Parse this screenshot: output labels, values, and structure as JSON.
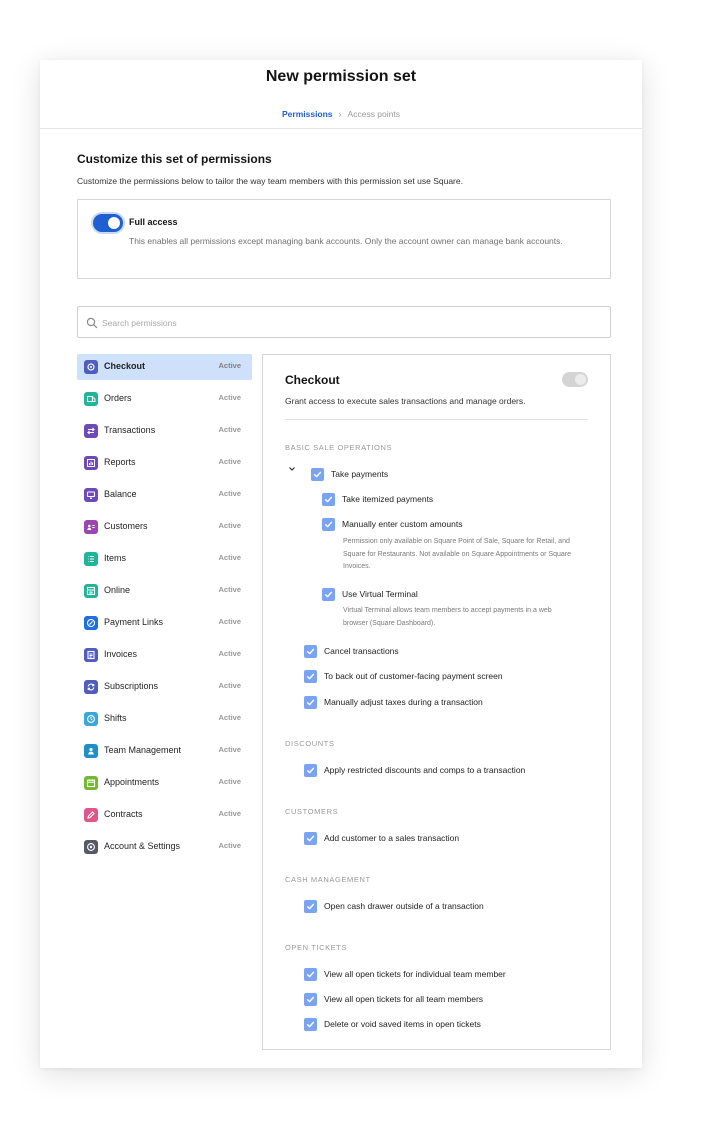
{
  "header": {
    "title": "New permission set",
    "breadcrumb": {
      "current": "Permissions",
      "separator": "›",
      "next": "Access points"
    }
  },
  "intro": {
    "title": "Customize this set of permissions",
    "description": "Customize the permissions below to tailor the way team members with this permission set use Square."
  },
  "full_access": {
    "label": "Full access",
    "description": "This enables all permissions except managing bank accounts. Only the account owner can manage bank accounts.",
    "enabled": true
  },
  "search": {
    "placeholder": "Search permissions",
    "value": ""
  },
  "sidebar": {
    "items": [
      {
        "label": "Checkout",
        "status": "Active",
        "icon": "checkout-icon",
        "color": "#4f5dbd",
        "selected": true
      },
      {
        "label": "Orders",
        "status": "Active",
        "icon": "orders-icon",
        "color": "#1fb59a"
      },
      {
        "label": "Transactions",
        "status": "Active",
        "icon": "transactions-icon",
        "color": "#6e4ab8"
      },
      {
        "label": "Reports",
        "status": "Active",
        "icon": "reports-icon",
        "color": "#6e4ab8"
      },
      {
        "label": "Balance",
        "status": "Active",
        "icon": "balance-icon",
        "color": "#6e4ab8"
      },
      {
        "label": "Customers",
        "status": "Active",
        "icon": "customers-icon",
        "color": "#9a48b0"
      },
      {
        "label": "Items",
        "status": "Active",
        "icon": "items-icon",
        "color": "#1fb59a"
      },
      {
        "label": "Online",
        "status": "Active",
        "icon": "online-icon",
        "color": "#1fb59a"
      },
      {
        "label": "Payment Links",
        "status": "Active",
        "icon": "payment-links-icon",
        "color": "#1f6fe0"
      },
      {
        "label": "Invoices",
        "status": "Active",
        "icon": "invoices-icon",
        "color": "#4f5dbd"
      },
      {
        "label": "Subscriptions",
        "status": "Active",
        "icon": "subscriptions-icon",
        "color": "#4f5dbd"
      },
      {
        "label": "Shifts",
        "status": "Active",
        "icon": "shifts-icon",
        "color": "#3aa7d8"
      },
      {
        "label": "Team Management",
        "status": "Active",
        "icon": "team-management-icon",
        "color": "#1f8fc8"
      },
      {
        "label": "Appointments",
        "status": "Active",
        "icon": "appointments-icon",
        "color": "#74b832"
      },
      {
        "label": "Contracts",
        "status": "Active",
        "icon": "contracts-icon",
        "color": "#e0568a"
      },
      {
        "label": "Account & Settings",
        "status": "Active",
        "icon": "account-settings-icon",
        "color": "#555a66"
      }
    ]
  },
  "panel": {
    "title": "Checkout",
    "description": "Grant access to execute sales transactions and manage orders.",
    "enabled": false,
    "groups": {
      "basic": {
        "heading": "BASIC SALE OPERATIONS",
        "take_payments": "Take payments",
        "itemized": "Take itemized payments",
        "custom_amounts": "Manually enter custom amounts",
        "custom_amounts_note": "Permission only available on Square Point of Sale, Square for Retail, and Square for Restaurants. Not available on Square Appointments or Square Invoices.",
        "virtual_terminal": "Use Virtual Terminal",
        "virtual_terminal_note": "Virtual Terminal allows team members to accept payments in a web browser (Square Dashboard).",
        "cancel": "Cancel transactions",
        "back_out": "To back out of customer-facing payment screen",
        "adjust_taxes": "Manually adjust taxes during a transaction"
      },
      "discounts": {
        "heading": "DISCOUNTS",
        "apply_restricted": "Apply restricted discounts and comps to a transaction"
      },
      "customers": {
        "heading": "CUSTOMERS",
        "add_customer": "Add customer to a sales transaction"
      },
      "cash": {
        "heading": "CASH MANAGEMENT",
        "open_drawer": "Open cash drawer outside of a transaction"
      },
      "tickets": {
        "heading": "OPEN TICKETS",
        "view_individual": "View all open tickets for individual team member",
        "view_all": "View all open tickets for all team members",
        "delete_void": "Delete or void saved items in open tickets"
      }
    }
  },
  "colors": {
    "accent": "#1f5fcf",
    "checkbox": "#7aa4f1",
    "selected_row": "#cfe0fb"
  }
}
